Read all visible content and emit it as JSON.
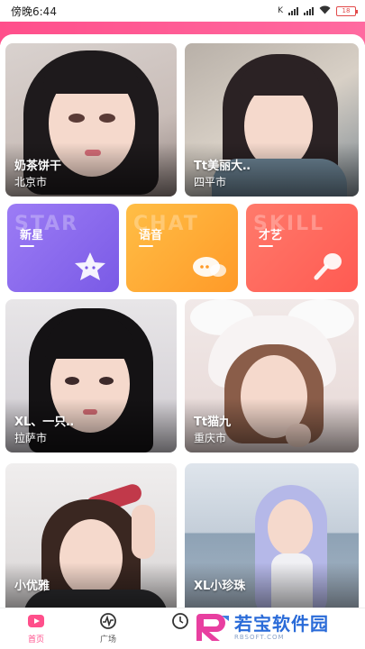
{
  "status_bar": {
    "time": "傍晚6:44",
    "battery": "18"
  },
  "cards": [
    {
      "name": "奶茶饼干",
      "city": "北京市"
    },
    {
      "name": "Tt美丽大‥",
      "city": "四平市"
    },
    {
      "name": "XL、一只‥",
      "city": "拉萨市"
    },
    {
      "name": "Tt猫九",
      "city": "重庆市"
    },
    {
      "name": "小优雅",
      "city": ""
    },
    {
      "name": "XL小珍珠",
      "city": ""
    }
  ],
  "categories": [
    {
      "label": "新星",
      "bg_word": "STAR",
      "icon": "star-icon"
    },
    {
      "label": "语音",
      "bg_word": "CHAT",
      "icon": "chat-bubble-icon"
    },
    {
      "label": "才艺",
      "bg_word": "SKILL",
      "icon": "microphone-icon"
    }
  ],
  "bottom_nav": [
    {
      "label": "首页",
      "icon": "video-home-icon",
      "active": true
    },
    {
      "label": "广场",
      "icon": "pulse-icon",
      "active": false
    },
    {
      "label": "",
      "icon": "clock-icon",
      "active": false
    }
  ],
  "watermark": {
    "title": "若宝软件园",
    "sub": "RBSOFT.COM"
  },
  "colors": {
    "accent": "#ff4f8b",
    "star": "#8a6af0",
    "voice": "#ffae38",
    "skill": "#ff6a5e",
    "watermark": "#2a6bd8"
  }
}
